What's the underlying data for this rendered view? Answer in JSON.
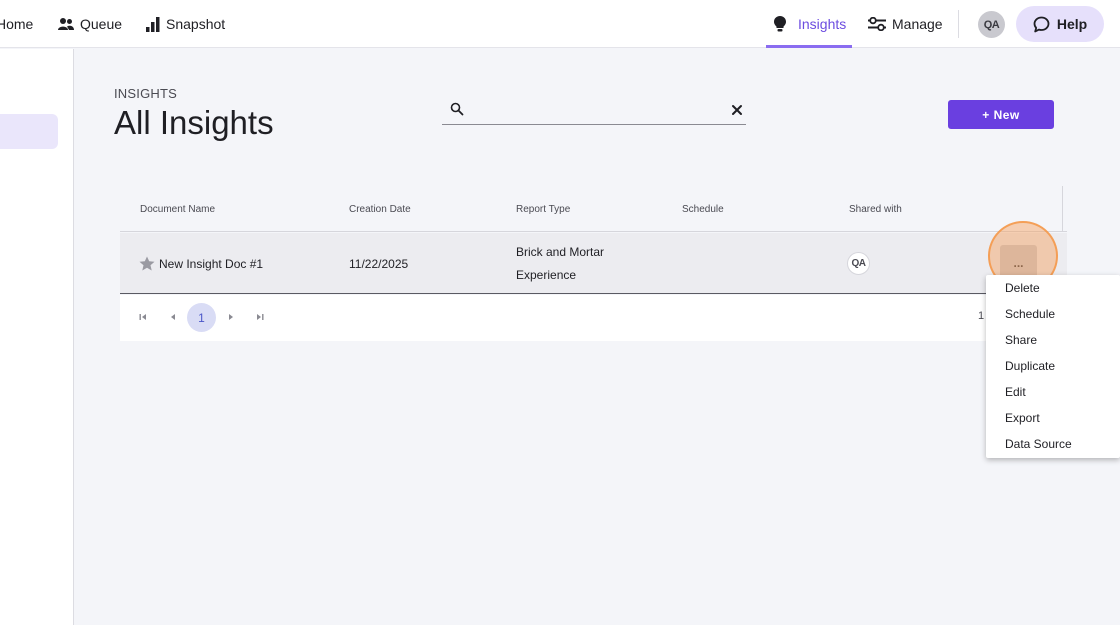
{
  "nav": {
    "home": "Home",
    "queue": "Queue",
    "snapshot": "Snapshot",
    "insights": "Insights",
    "manage": "Manage",
    "user_initials": "QA",
    "help": "Help"
  },
  "header": {
    "breadcrumb": "INSIGHTS",
    "title": "All Insights",
    "new_button": "+ New"
  },
  "search": {
    "value": "",
    "placeholder": ""
  },
  "table": {
    "columns": [
      "Document Name",
      "Creation Date",
      "Report Type",
      "Schedule",
      "Shared with"
    ],
    "rows": [
      {
        "name": "New Insight Doc #1",
        "date": "11/22/2025",
        "report_type_line1": "Brick and Mortar",
        "report_type_line2": "Experience",
        "schedule": "",
        "shared_initials": "QA",
        "more": "..."
      }
    ]
  },
  "pager": {
    "current_page": "1",
    "info": "1"
  },
  "menu": {
    "items": [
      "Delete",
      "Schedule",
      "Share",
      "Duplicate",
      "Edit",
      "Export",
      "Data Source"
    ]
  },
  "colors": {
    "accent": "#6a3fe0",
    "active_nav": "#6c4ce0",
    "click_highlight": "#f7a05a"
  }
}
